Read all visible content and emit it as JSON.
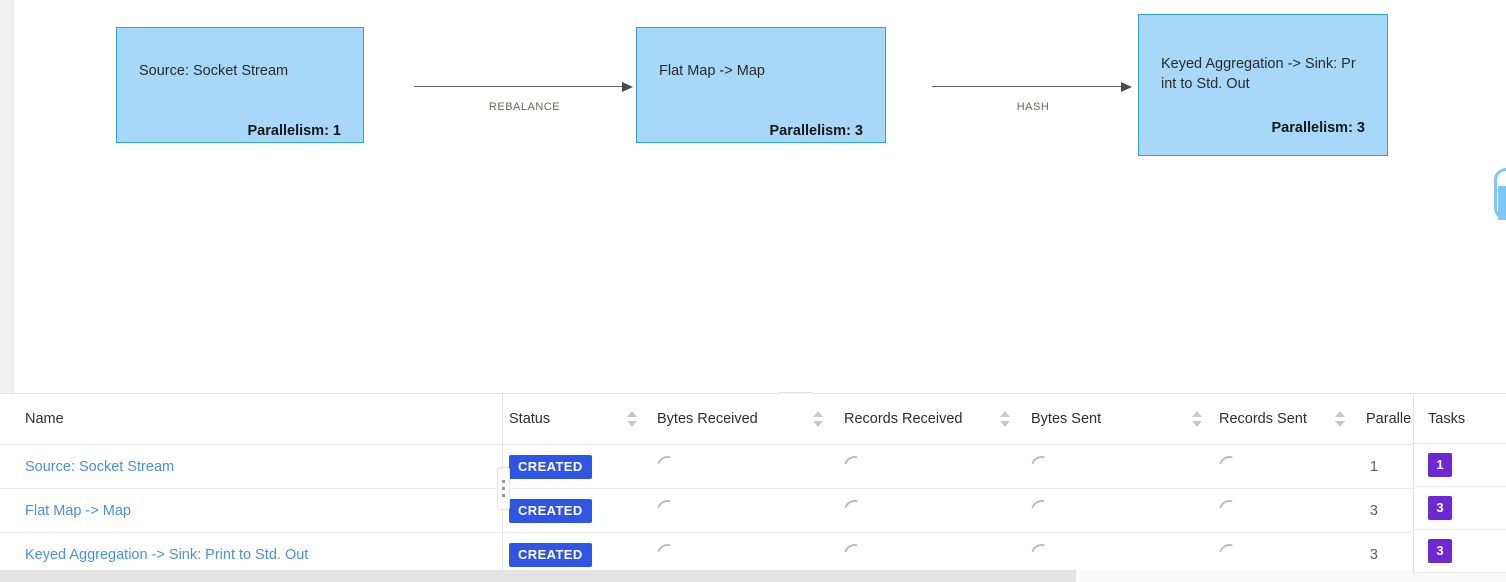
{
  "graph": {
    "nodes": [
      {
        "id": "node-0",
        "title": "Source: Socket Stream",
        "parallelism": "Parallelism: 1"
      },
      {
        "id": "node-1",
        "title": "Flat Map -> Map",
        "parallelism": "Parallelism: 3"
      },
      {
        "id": "node-2",
        "title": "Keyed Aggregation -> Sink: Pr\nint to Std. Out",
        "parallelism": "Parallelism: 3"
      }
    ],
    "edges": [
      {
        "id": "edge-0",
        "label": "REBALANCE"
      },
      {
        "id": "edge-1",
        "label": "HASH"
      }
    ],
    "node_fill": "#a7d8f7",
    "node_border": "#29a0e8"
  },
  "splitter": {
    "name": "pane-splitter",
    "dots": 3
  },
  "table": {
    "columns": [
      {
        "key": "name",
        "label": "Name",
        "sortable": false,
        "align": "left"
      },
      {
        "key": "status",
        "label": "Status",
        "sortable": true,
        "align": "left"
      },
      {
        "key": "bytes_received",
        "label": "Bytes Received",
        "sortable": true,
        "align": "left"
      },
      {
        "key": "records_received",
        "label": "Records Received",
        "sortable": true,
        "align": "left"
      },
      {
        "key": "bytes_sent",
        "label": "Bytes Sent",
        "sortable": true,
        "align": "left"
      },
      {
        "key": "records_sent",
        "label": "Records Sent",
        "sortable": true,
        "align": "left"
      },
      {
        "key": "parallelism",
        "label": "Parallelism",
        "sortable": false,
        "align": "right"
      },
      {
        "key": "tasks",
        "label": "Tasks",
        "sortable": false,
        "align": "left",
        "pinned": "right"
      }
    ],
    "rows": [
      {
        "name": "Source: Socket Stream",
        "status": "CREATED",
        "bytes_received": "",
        "records_received": "",
        "bytes_sent": "",
        "records_sent": "",
        "parallelism": "1",
        "tasks": "1"
      },
      {
        "name": "Flat Map -> Map",
        "status": "CREATED",
        "bytes_received": "",
        "records_received": "",
        "bytes_sent": "",
        "records_sent": "",
        "parallelism": "3",
        "tasks": "3"
      },
      {
        "name": "Keyed Aggregation -> Sink: Print to Std. Out",
        "status": "CREATED",
        "bytes_received": "",
        "records_received": "",
        "bytes_sent": "",
        "records_sent": "",
        "parallelism": "3",
        "tasks": "3"
      }
    ],
    "status_badge_color": "#2f55e6",
    "tasks_badge_color": "#6d28d4",
    "link_color": "#4a90e2"
  },
  "scrollbar": {
    "orientation": "horizontal",
    "thumb_name": "horizontal-scrollbar-thumb"
  }
}
